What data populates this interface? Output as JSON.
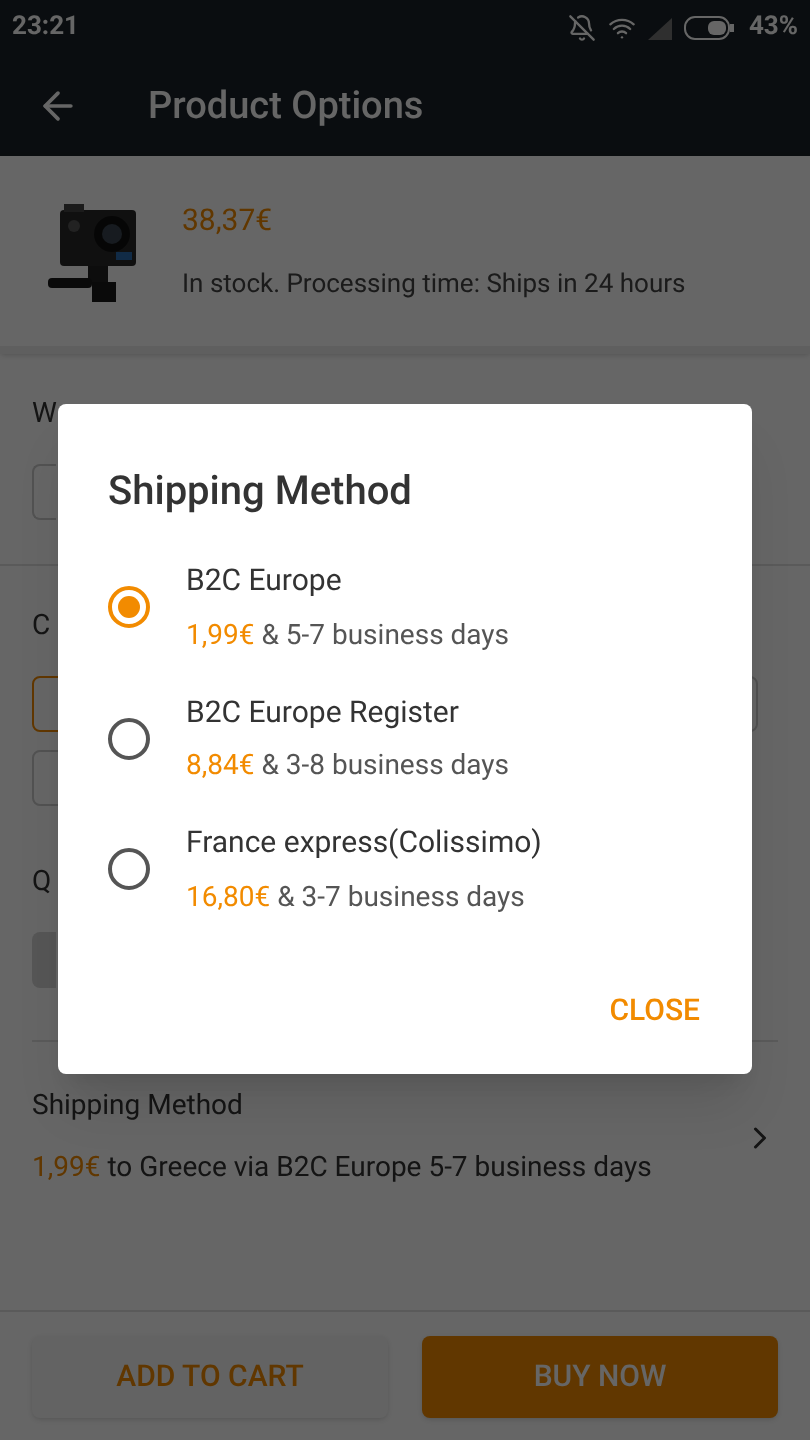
{
  "status_bar": {
    "time": "23:21",
    "battery": "43%"
  },
  "header": {
    "title": "Product Options"
  },
  "product": {
    "price": "38,37€",
    "stock": "In stock. Processing time: Ships in 24 hours"
  },
  "warehouse": {
    "label": "W"
  },
  "color": {
    "label": "C",
    "options": [
      {
        "selected": true
      },
      {
        "selected": false
      },
      {
        "selected": false
      }
    ]
  },
  "quantity": {
    "label": "Q"
  },
  "shipping": {
    "label": "Shipping Method",
    "price": "1,99€",
    "summary": "to Greece via B2C Europe 5-7 business days"
  },
  "buttons": [
    {
      "label": "ADD TO CART",
      "kind": "secondary"
    },
    {
      "label": "BUY NOW",
      "kind": "primary"
    }
  ],
  "dialog": {
    "title": "Shipping Method",
    "options": [
      {
        "name": "B2C Europe",
        "price": "1,99€",
        "time": "& 5-7 business days",
        "selected": true
      },
      {
        "name": "B2C Europe Register",
        "price": "8,84€",
        "time": "& 3-8 business days",
        "selected": false
      },
      {
        "name": "France express(Colissimo)",
        "price": "16,80€",
        "time": "& 3-7 business days",
        "selected": false
      }
    ],
    "close": "CLOSE"
  }
}
